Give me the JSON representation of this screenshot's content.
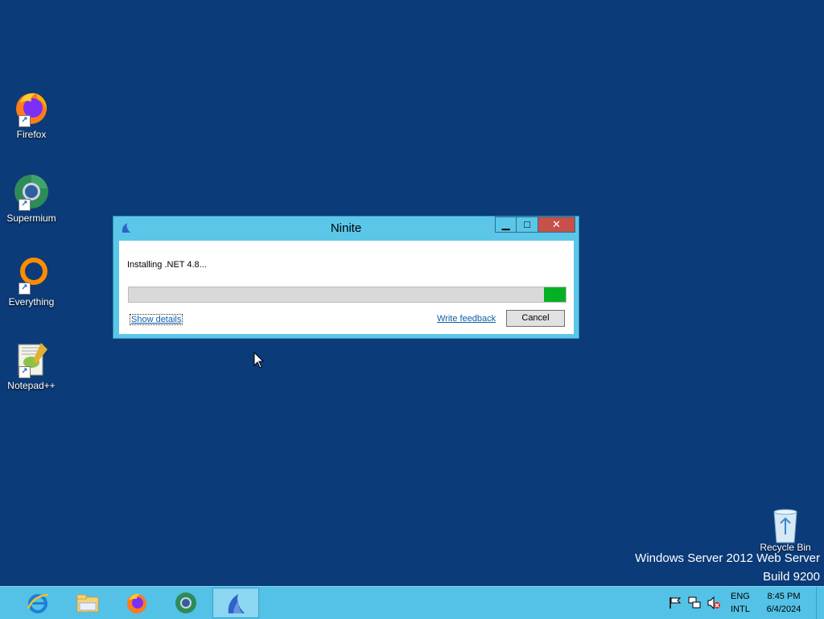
{
  "desktop": {
    "icons": [
      {
        "label": "Firefox",
        "icon": "firefox-icon"
      },
      {
        "label": "Supermium",
        "icon": "supermium-icon"
      },
      {
        "label": "Everything",
        "icon": "everything-icon"
      },
      {
        "label": "Notepad++",
        "icon": "notepad-plus-plus-icon"
      }
    ],
    "recycle_bin": {
      "label": "Recycle Bin",
      "icon": "recycle-bin-icon"
    },
    "watermark": {
      "line1": "Windows Server 2012 Web Server",
      "line2": "Build 9200"
    }
  },
  "dialog": {
    "title": "Ninite",
    "status": "Installing .NET 4.8...",
    "progress": 0.05,
    "show_details": "Show details",
    "write_feedback": "Write feedback",
    "cancel": "Cancel",
    "controls": {
      "minimize": "minimize-icon",
      "maximize": "maximize-icon",
      "close": "close-icon"
    }
  },
  "taskbar": {
    "items": [
      "internet-explorer-icon",
      "file-explorer-icon",
      "firefox-icon",
      "supermium-icon",
      "ninite-icon"
    ],
    "active_item": "ninite-icon",
    "tray": {
      "icons": [
        "flag-icon",
        "network-icon",
        "volume-muted-icon"
      ],
      "language_line1": "ENG",
      "language_line2": "INTL",
      "time": "8:45 PM",
      "date": "6/4/2024"
    }
  },
  "colors": {
    "desktop_bg": "#0b3b78",
    "window_frame": "#5bc6e8",
    "close_button": "#c7504a",
    "progress_fill": "#06b025",
    "taskbar": "#54c1e6",
    "link": "#0f5fa8"
  }
}
